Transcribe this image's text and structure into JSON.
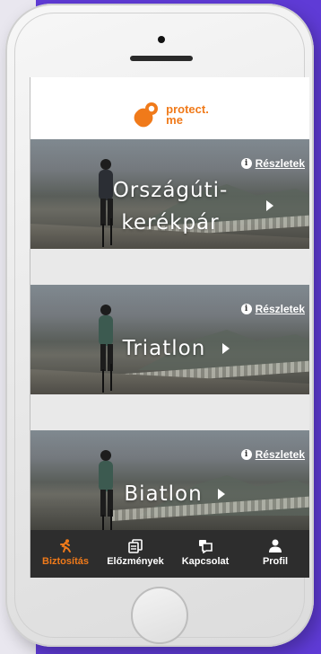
{
  "app": {
    "logo_line1": "protect.",
    "logo_line2": "me",
    "brand_color": "#f07a1a"
  },
  "cards": [
    {
      "title_line1": "Országúti-",
      "title_line2": "kerékpár",
      "details_label": "Részletek"
    },
    {
      "title": "Triatlon",
      "details_label": "Részletek"
    },
    {
      "title": "Biatlon",
      "details_label": "Részletek"
    }
  ],
  "tabbar": {
    "tabs": [
      {
        "label": "Biztosítás",
        "icon": "running-person-icon",
        "active": true
      },
      {
        "label": "Előzmények",
        "icon": "documents-icon",
        "active": false
      },
      {
        "label": "Kapcsolat",
        "icon": "chat-icon",
        "active": false
      },
      {
        "label": "Profil",
        "icon": "person-icon",
        "active": false
      }
    ],
    "background": "#2d2d2d",
    "active_color": "#f07a1a"
  }
}
